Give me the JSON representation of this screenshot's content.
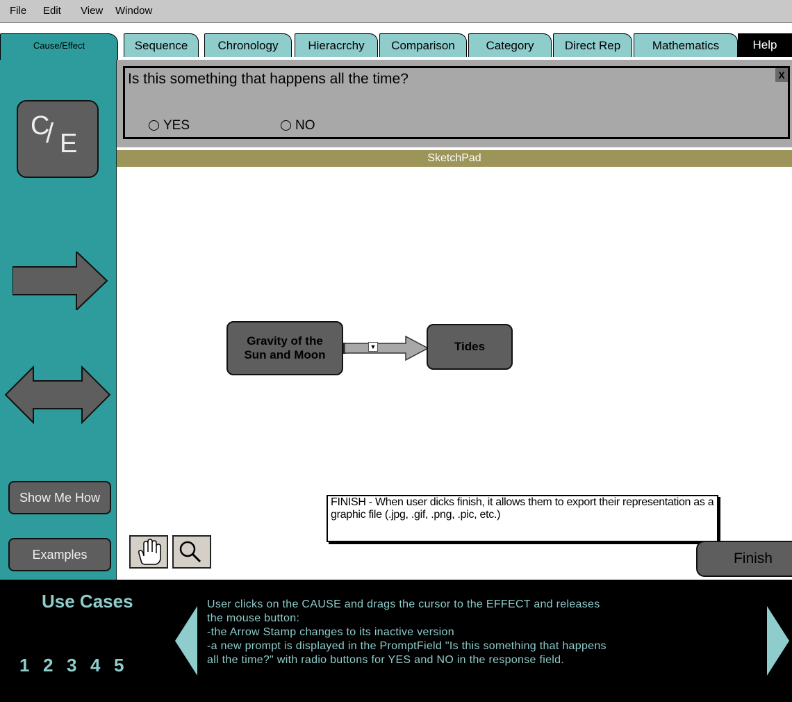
{
  "menu": [
    "File",
    "Edit",
    "View",
    "Window"
  ],
  "tabs": {
    "active": "Cause/Effect",
    "items": [
      "Sequence",
      "Chronology",
      "Hieracrchy",
      "Comparison",
      "Category",
      "Direct Rep",
      "Mathematics"
    ],
    "help": "Help"
  },
  "sidebar": {
    "ce_button": {
      "c": "C",
      "slash": "/",
      "e": "E"
    },
    "show_me_how": "Show Me How",
    "examples": "Examples"
  },
  "prompt": {
    "question": "Is this something that happens all the time?",
    "close": "X",
    "options": [
      "YES",
      "NO"
    ]
  },
  "sketchpad": {
    "title": "SketchPad",
    "cause_node": "Gravity of the\nSun and Moon",
    "effect_node": "Tides",
    "dropdown_glyph": "▼"
  },
  "annotation": "FINISH - When user dicks finish, it allows them to export their representation as a graphic file (.jpg, .gif, .png, .pic, etc.)",
  "finish_label": "Finish",
  "use_cases": {
    "title": "Use Cases",
    "numbers": [
      "1",
      "2",
      "3",
      "4",
      "5"
    ],
    "text_lines": [
      "User clicks on the CAUSE and drags the cursor to the EFFECT and releases",
      "the mouse button:",
      "-the Arrow Stamp changes to its inactive version",
      "-a new prompt is displayed in the PromptField \"Is this something that happens",
      "all the time?\" with radio buttons for YES and NO in the response field."
    ]
  },
  "colors": {
    "teal": "#2e9c9c",
    "tab_teal": "#8fcccc",
    "node_gray": "#5e5e5e",
    "prompt_gray": "#a8a8a8",
    "sketchpad_olive": "#9c9458"
  },
  "icons": [
    "hand-icon",
    "magnifier-icon",
    "arrow-stamp-icon",
    "double-arrow-stamp-icon",
    "close-icon",
    "left-arrow-icon",
    "right-arrow-icon"
  ]
}
